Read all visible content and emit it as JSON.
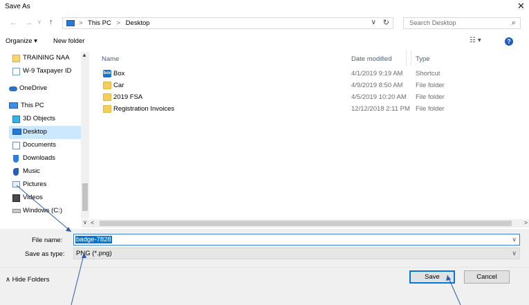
{
  "window": {
    "title": "Save As",
    "close_glyph": "✕"
  },
  "nav_glyphs": {
    "back": "←",
    "forward": "→",
    "recent": "∨",
    "up": "↑"
  },
  "address": {
    "sep": ">",
    "crumb1": "This PC",
    "crumb2": "Desktop",
    "dropdown": "∨",
    "refresh": "↻"
  },
  "search": {
    "placeholder": "Search Desktop",
    "icon": "⌕"
  },
  "toolbar": {
    "organize": "Organize ▾",
    "new_folder": "New folder",
    "view_icon": "☷ ▾",
    "help": "?"
  },
  "sidebar": {
    "items": [
      {
        "label": "TRAINING NAA",
        "icon": "folder-icon"
      },
      {
        "label": "W-9 Taxpayer ID",
        "icon": "document-icon"
      },
      {
        "label": "OneDrive",
        "icon": "cloud-icon"
      },
      {
        "label": "This PC",
        "icon": "computer-icon"
      },
      {
        "label": "3D Objects",
        "icon": "cube-icon"
      },
      {
        "label": "Desktop",
        "icon": "desktop-icon"
      },
      {
        "label": "Documents",
        "icon": "documents-icon"
      },
      {
        "label": "Downloads",
        "icon": "download-icon"
      },
      {
        "label": "Music",
        "icon": "music-icon"
      },
      {
        "label": "Pictures",
        "icon": "pictures-icon"
      },
      {
        "label": "Videos",
        "icon": "videos-icon"
      },
      {
        "label": "Windows (C:)",
        "icon": "drive-icon"
      }
    ],
    "selected": "Desktop"
  },
  "columns": {
    "name": "Name",
    "date": "Date modified",
    "type": "Type"
  },
  "files": [
    {
      "name": "Box",
      "date": "4/1/2019 9:19 AM",
      "type": "Shortcut",
      "icon": "box-icon",
      "icon_text": "box"
    },
    {
      "name": "Car",
      "date": "4/9/2019 8:50 AM",
      "type": "File folder",
      "icon": "folder-icon"
    },
    {
      "name": "2019 FSA",
      "date": "4/5/2019 10:20 AM",
      "type": "File folder",
      "icon": "folder-icon"
    },
    {
      "name": "Registration Invoices",
      "date": "12/12/2018 2:11 PM",
      "type": "File folder",
      "icon": "folder-icon"
    }
  ],
  "scroll_glyphs": {
    "up": "▲",
    "left": "<",
    "right": ">",
    "down": "∨"
  },
  "form": {
    "filename_label": "File name:",
    "filename_value": "badge-7828",
    "savetype_label": "Save as type:",
    "savetype_value": "PNG (*.png)",
    "dropdown": "∨"
  },
  "footer": {
    "hide_folders": "∧  Hide Folders",
    "save": "Save",
    "cancel": "Cancel"
  },
  "colors": {
    "accent": "#0078d7",
    "selection": "#cce8ff",
    "folder": "#f6cd5a",
    "chrome": "#f0f0f0"
  }
}
